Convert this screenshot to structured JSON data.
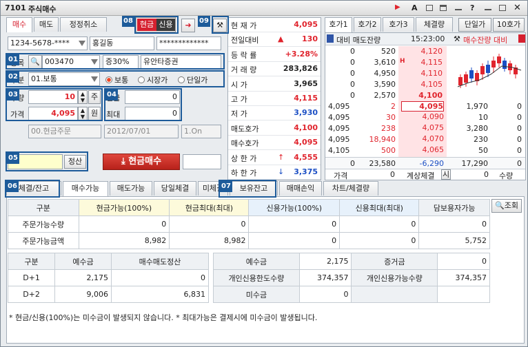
{
  "title": {
    "code": "7101",
    "name": "주식매수"
  },
  "titlebar_icons": {
    "play": "▶",
    "a": "A",
    "help": "?"
  },
  "order_tabs": [
    "매수",
    "매도",
    "정정취소"
  ],
  "cash_credit": {
    "cash": "현금",
    "credit": "신용"
  },
  "account": {
    "number": "1234-5678-****",
    "holder": "홍길동",
    "password": "*************"
  },
  "stock": {
    "label": "종목",
    "code": "003470",
    "margin": "증30%",
    "name": "유안타증권"
  },
  "order_type": {
    "label": "구분",
    "value": "01.보통",
    "options": [
      "보통",
      "시장가",
      "단일가"
    ],
    "selected": "보통"
  },
  "quantity": {
    "label": "수량",
    "value": "10",
    "unit": "주"
  },
  "price": {
    "label": "가격",
    "value": "4,095",
    "unit": "원"
  },
  "cash_info": {
    "cash_label": "현금",
    "cash_value": "0",
    "max_label": "최대",
    "max_value": "0"
  },
  "order_cond": {
    "type": "00.현금주문",
    "date": "2012/07/01",
    "on": "1.On"
  },
  "settle_button": "정산",
  "buy_button": "현금매수",
  "quote": {
    "rows": [
      {
        "label": "현 재 가",
        "value": "4,095",
        "cls": "red"
      },
      {
        "label": "전일대비",
        "value": "130",
        "cls": "red",
        "mark": "▲"
      },
      {
        "label": "등 락 률",
        "value": "+3.28%",
        "cls": "red"
      },
      {
        "label": "거 래 량",
        "value": "283,826",
        "cls": ""
      },
      {
        "label": "시    가",
        "value": "3,965",
        "cls": ""
      },
      {
        "label": "고    가",
        "value": "4,115",
        "cls": "red"
      },
      {
        "label": "저    가",
        "value": "3,930",
        "cls": "blue"
      },
      {
        "label": "매도호가",
        "value": "4,100",
        "cls": "red"
      },
      {
        "label": "매수호가",
        "value": "4,095",
        "cls": "red"
      },
      {
        "label": "상 한 가",
        "value": "4,555",
        "cls": "red",
        "mark": "↑"
      },
      {
        "label": "하 한 가",
        "value": "3,375",
        "cls": "blue",
        "mark": "↓"
      }
    ]
  },
  "book_tabs": [
    "호가1",
    "호가2",
    "호가3",
    "체결량",
    "단일가",
    "10호가"
  ],
  "book_header": {
    "left": "대비 매도잔량",
    "time": "15:23:00",
    "right": "매수잔량 대비"
  },
  "asks": [
    {
      "diff": "0",
      "qty": "520",
      "price": "4,120"
    },
    {
      "diff": "0",
      "qty": "3,610",
      "price": "4,115",
      "h": "H"
    },
    {
      "diff": "0",
      "qty": "4,950",
      "price": "4,110"
    },
    {
      "diff": "0",
      "qty": "3,590",
      "price": "4,105"
    },
    {
      "diff": "0",
      "qty": "2,570",
      "price": "4,100"
    }
  ],
  "bids": [
    {
      "ldiff": "4,095",
      "lqty": "2",
      "price": "4,095",
      "qty": "1,970",
      "diff": "0"
    },
    {
      "ldiff": "4,095",
      "lqty": "30",
      "price": "4,090",
      "qty": "10",
      "diff": "0"
    },
    {
      "ldiff": "4,095",
      "lqty": "238",
      "price": "4,075",
      "qty": "3,280",
      "diff": "0"
    },
    {
      "ldiff": "4,095",
      "lqty": "18,940",
      "price": "4,070",
      "qty": "230",
      "diff": "0"
    },
    {
      "ldiff": "4,105",
      "lqty": "500",
      "price": "4,065",
      "qty": "50",
      "diff": "0"
    }
  ],
  "book_total": {
    "ldiff": "0",
    "ask_total": "23,580",
    "diff": "-6,290",
    "bid_total": "17,290",
    "rdiff": "0"
  },
  "book_footer": {
    "price_label": "가격",
    "price_value": "0",
    "calc_label": "계상체결",
    "calc_btn": "시",
    "qty_value": "0",
    "qty_label": "수량"
  },
  "bottom_tabs": [
    "체결/잔고",
    "매수가능",
    "매도가능",
    "당일체결",
    "미체결",
    "보유잔고",
    "매매손익",
    "차트/체결량"
  ],
  "lookup_button": "조회",
  "avail_table": {
    "headers": [
      "구분",
      "현금가능(100%)",
      "현금최대(최대)",
      "신용가능(100%)",
      "신용최대(최대)",
      "담보용자가능"
    ],
    "rows": [
      [
        "주문가능수량",
        "0",
        "0",
        "0",
        "0",
        "0"
      ],
      [
        "주문가능금액",
        "8,982",
        "8,982",
        "0",
        "0",
        "5,752"
      ]
    ]
  },
  "deposit_table": {
    "headers": [
      "구분",
      "예수금",
      "매수매도정산"
    ],
    "rows": [
      [
        "D+1",
        "2,175",
        "0"
      ],
      [
        "D+2",
        "9,006",
        "6,831"
      ]
    ]
  },
  "credit_table": {
    "rows": [
      [
        "예수금",
        "2,175",
        "증거금",
        "0"
      ],
      [
        "개인신용한도수량",
        "374,357",
        "개인신용가능수량",
        "374,357"
      ],
      [
        "미수금",
        "0",
        "",
        ""
      ]
    ]
  },
  "footnote": "* 현금/신용(100%)는 미수금이 발생되지 않습니다. * 최대가능은 결제시에 미수금이 발생됩니다.",
  "badges": [
    "01",
    "02",
    "03",
    "04",
    "05",
    "06",
    "07",
    "08",
    "09"
  ]
}
